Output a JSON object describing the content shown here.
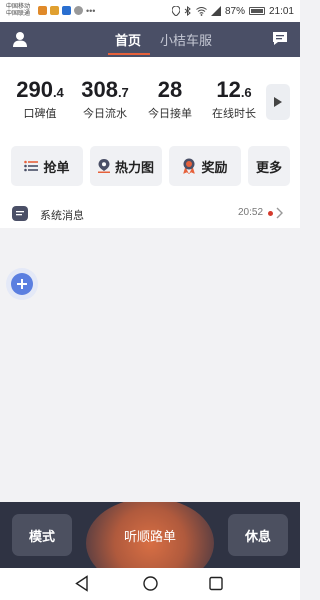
{
  "status_bar": {
    "carrier_line1": "中国移动",
    "carrier_line2": "中国联通",
    "battery": "87%",
    "time": "21:01",
    "battery_level": 0.87
  },
  "header": {
    "tab_home": "首页",
    "tab_service": "小桔车服"
  },
  "stats": [
    {
      "value": "290",
      "decimal": ".4",
      "label": "口碑值"
    },
    {
      "value": "308",
      "decimal": ".7",
      "label": "今日流水"
    },
    {
      "value": "28",
      "decimal": "",
      "label": "今日接单"
    },
    {
      "value": "12",
      "decimal": ".6",
      "label": "在线时长"
    }
  ],
  "actions": {
    "grab": "抢单",
    "heatmap": "热力图",
    "reward": "奖励",
    "more": "更多"
  },
  "message": {
    "title": "系统消息",
    "time": "20:52"
  },
  "bottom": {
    "mode": "模式",
    "listen": "听顺路单",
    "rest": "休息"
  },
  "colors": {
    "header_bg": "#4a4f66",
    "accent": "#e6613b",
    "bottom_bg": "#2f3343",
    "fab": "#5b7fe0"
  }
}
